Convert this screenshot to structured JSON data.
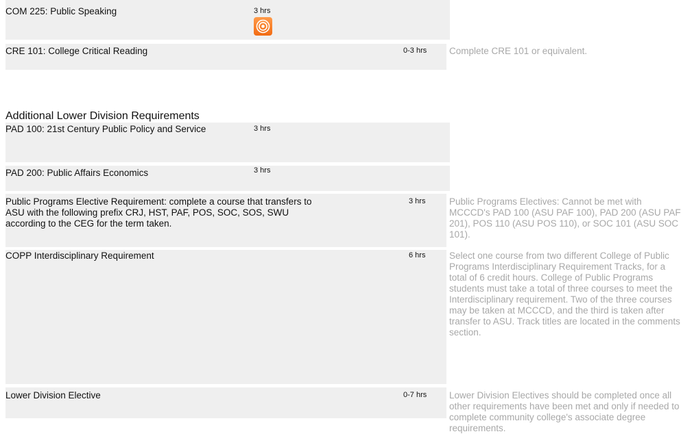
{
  "courses_top": [
    {
      "name": "COM 225: Public Speaking",
      "hours": "3 hrs",
      "note": ""
    },
    {
      "name": "CRE 101: College Critical Reading",
      "hours": "0-3 hrs",
      "note": "Complete CRE 101 or equivalent."
    }
  ],
  "section": {
    "title": "Additional Lower Division Requirements"
  },
  "courses": [
    {
      "name": "PAD 100: 21st Century Public Policy and Service",
      "hours": "3 hrs",
      "note": ""
    },
    {
      "name": "PAD 200: Public Affairs Economics",
      "hours": "3 hrs",
      "note": ""
    },
    {
      "name": "Public Programs Elective Requirement: complete a course that transfers to ASU with the following prefix CRJ, HST, PAF, POS, SOC, SOS, SWU according to the CEG for the term taken.",
      "hours": "3 hrs",
      "note": "Public Programs Electives: Cannot be met with MCCCD's PAD 100 (ASU PAF 100), PAD 200 (ASU PAF 201), POS 110 (ASU POS 110), or SOC 101 (ASU SOC 101)."
    },
    {
      "name": "COPP Interdisciplinary Requirement",
      "hours": "6 hrs",
      "note": "Select one course from two different College of Public Programs Interdisciplinary Requirement Tracks, for a total of 6 credit hours. College of Public Programs students must take a total of three courses to meet the Interdisciplinary requirement. Two of the three courses may be taken at MCCCD, and the third is taken after transfer to ASU. Track titles are located in the comments section."
    },
    {
      "name": "Lower Division Elective",
      "hours": "0-7 hrs",
      "note": "Lower Division Electives should be completed once all other requirements have been met and only if needed to complete community college's associate degree requirements."
    }
  ],
  "badge": {
    "icon": "target-icon",
    "color": "#f26b13"
  }
}
